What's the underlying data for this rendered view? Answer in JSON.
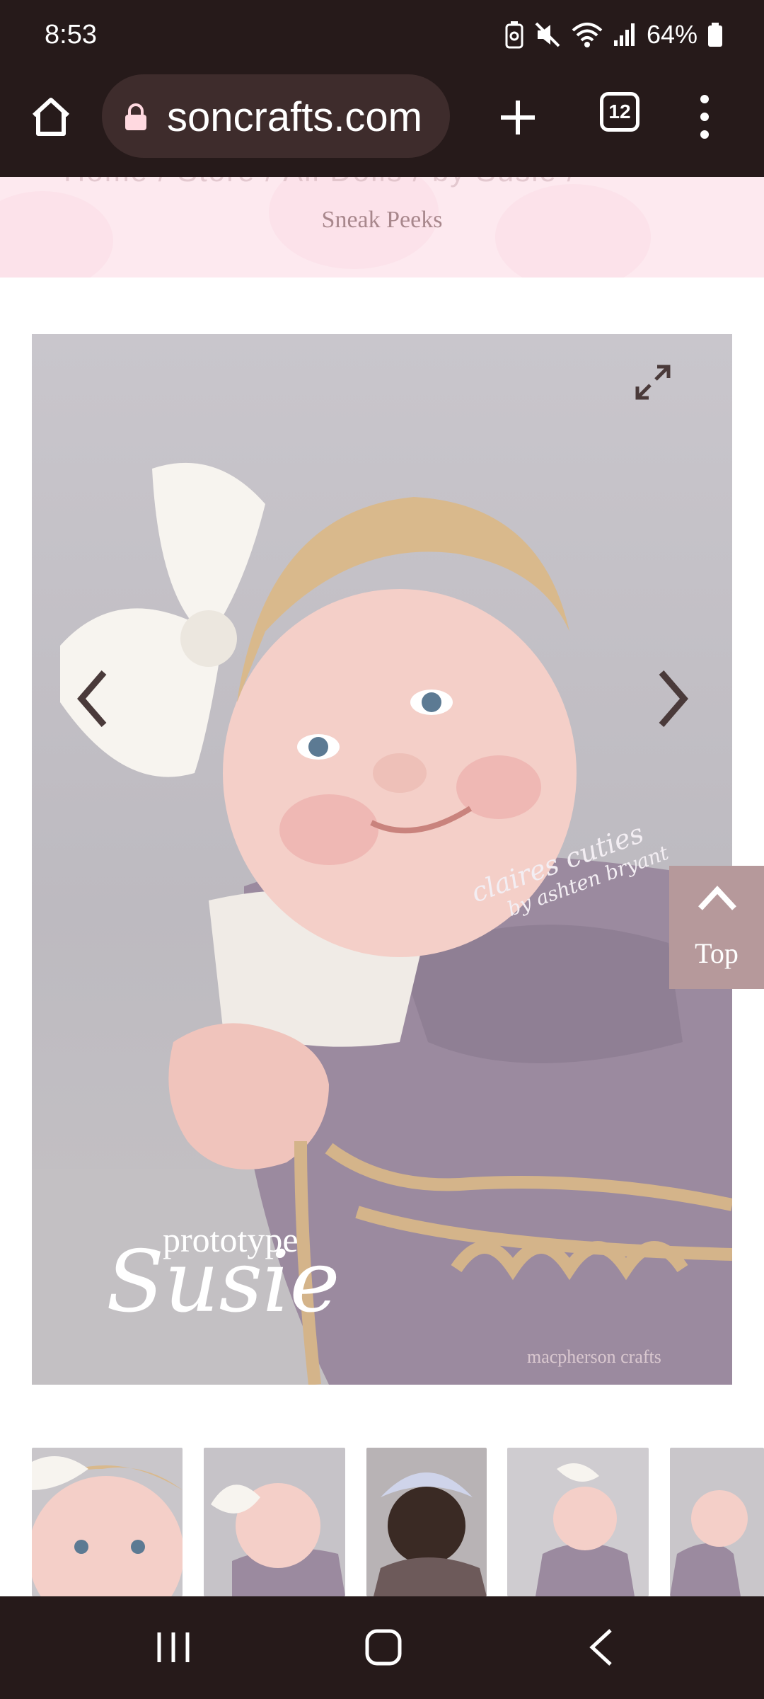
{
  "status_bar": {
    "time": "8:53",
    "battery": "64%",
    "icons": [
      "battery-saver-icon",
      "mute-icon",
      "wifi-icon",
      "signal-icon",
      "battery-icon"
    ]
  },
  "browser": {
    "url": "soncrafts.com",
    "tab_count": "12",
    "icons": [
      "home-icon",
      "lock-icon",
      "plus-icon",
      "tabs-icon",
      "more-vert-icon"
    ]
  },
  "breadcrumb": {
    "ghost_text": "Home  /  Store  /  All Dolls  /  by Susie  /",
    "current": "Sneak Peeks"
  },
  "gallery": {
    "watermark_sub": "prototype",
    "watermark_main": "Susie",
    "artist_script": "claires cuties",
    "artist_by": "by ashten bryant",
    "brand_watermark": "macpherson crafts",
    "icons": [
      "expand-icon",
      "chevron-left-icon",
      "chevron-right-icon"
    ]
  },
  "back_to_top": {
    "label": "Top"
  },
  "thumbnails": {
    "count_visible": 5
  },
  "colors": {
    "chrome": "#261a1a",
    "url_bar": "#3e2c2c",
    "breadcrumb_band": "#fde9ef",
    "accent": "#b6999b",
    "overall_purple": "#9b8a9f"
  }
}
